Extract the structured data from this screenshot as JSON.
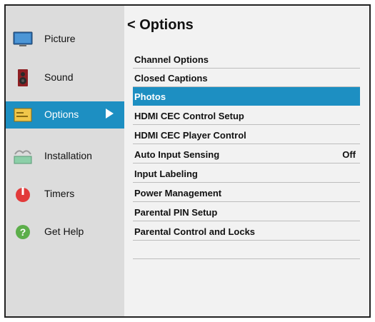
{
  "sidebar": {
    "items": [
      {
        "label": "Picture",
        "icon": "monitor-icon"
      },
      {
        "label": "Sound",
        "icon": "speaker-icon"
      },
      {
        "label": "Options",
        "icon": "options-icon"
      },
      {
        "label": "Installation",
        "icon": "installation-icon"
      },
      {
        "label": "Timers",
        "icon": "timer-icon"
      },
      {
        "label": "Get Help",
        "icon": "help-icon"
      }
    ],
    "active_index": 2
  },
  "main": {
    "title": "< Options",
    "items": [
      {
        "label": "Channel Options",
        "value": ""
      },
      {
        "label": "Closed Captions",
        "value": ""
      },
      {
        "label": "Photos",
        "value": ""
      },
      {
        "label": "HDMI CEC Control Setup",
        "value": ""
      },
      {
        "label": "HDMI CEC Player Control",
        "value": ""
      },
      {
        "label": "Auto Input Sensing",
        "value": "Off"
      },
      {
        "label": "Input Labeling",
        "value": ""
      },
      {
        "label": "Power Management",
        "value": ""
      },
      {
        "label": "Parental PIN Setup",
        "value": ""
      },
      {
        "label": "Parental Control and Locks",
        "value": ""
      }
    ],
    "selected_index": 2
  },
  "colors": {
    "accent": "#1d8fc2",
    "sidebar_bg": "#dcdcdc",
    "main_bg": "#f2f2f2"
  }
}
